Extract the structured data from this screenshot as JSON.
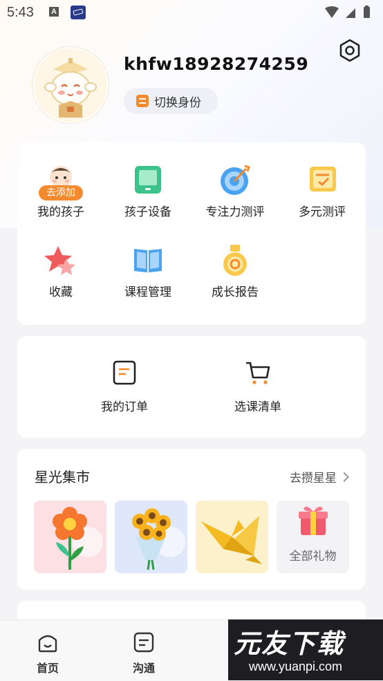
{
  "status_bar": {
    "time": "5:43",
    "a_badge": "A"
  },
  "profile": {
    "username": "khfw18928274259",
    "switch_label": "切换身份"
  },
  "services": [
    {
      "label": "我的孩子",
      "badge": "去添加",
      "icon": "child-face-icon"
    },
    {
      "label": "孩子设备",
      "icon": "tablet-icon"
    },
    {
      "label": "专注力测评",
      "icon": "target-dart-icon"
    },
    {
      "label": "多元测评",
      "icon": "checklist-icon"
    },
    {
      "label": "收藏",
      "icon": "star-icon"
    },
    {
      "label": "课程管理",
      "icon": "book-icon"
    },
    {
      "label": "成长报告",
      "icon": "medal-icon"
    }
  ],
  "orders": [
    {
      "label": "我的订单",
      "icon": "order-document-icon"
    },
    {
      "label": "选课清单",
      "icon": "shopping-cart-icon"
    }
  ],
  "market": {
    "title": "星光集市",
    "link": "去攒星星",
    "tiles": [
      {
        "name": "flower",
        "color": "#fde0e3"
      },
      {
        "name": "sunflower-bouquet",
        "color": "#dfe7fb"
      },
      {
        "name": "paper-crane",
        "color": "#fdf1cc"
      },
      {
        "name": "all-gifts",
        "label": "全部礼物",
        "color": "#f3f3f5"
      }
    ]
  },
  "nav": [
    {
      "label": "首页",
      "icon": "home-icon"
    },
    {
      "label": "沟通",
      "icon": "message-icon"
    }
  ],
  "watermark": {
    "main": "元友下载",
    "sub": "www.yuanpi.com"
  },
  "colors": {
    "accent_orange": "#f48a2e",
    "blue": "#4aa3f0",
    "green": "#3cc28b"
  }
}
